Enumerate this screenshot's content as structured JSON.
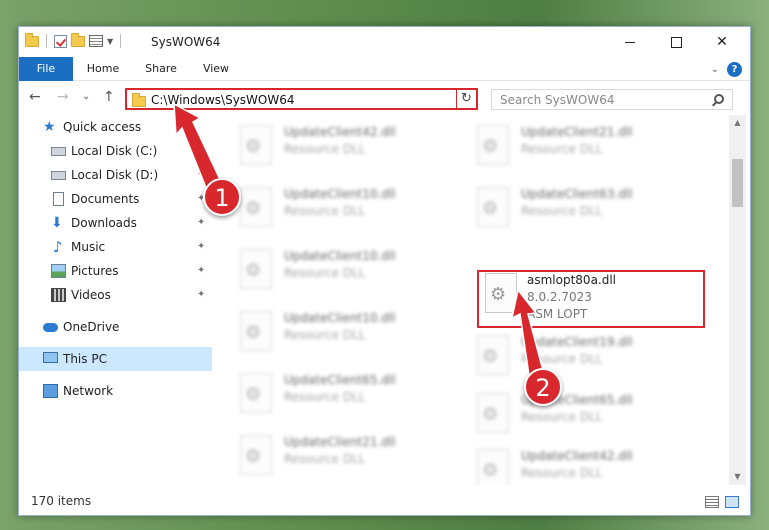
{
  "window": {
    "title": "SysWOW64",
    "controls": {
      "minimize": "",
      "maximize": "",
      "close": "✕"
    }
  },
  "ribbon": {
    "tabs": [
      "File",
      "Home",
      "Share",
      "View"
    ],
    "help": "?"
  },
  "address": {
    "path": "C:\\Windows\\SysWOW64",
    "refresh": "↻",
    "dropdown": "⌄",
    "search_placeholder": "Search SysWOW64"
  },
  "nav_buttons": {
    "back": "←",
    "forward": "→",
    "recent": "⌄",
    "up": "↑"
  },
  "sidebar": {
    "items": [
      {
        "label": "Quick access",
        "icon": "star-icon",
        "pinned": false
      },
      {
        "label": "Local Disk (C:)",
        "icon": "disk-icon",
        "pinned": true
      },
      {
        "label": "Local Disk (D:)",
        "icon": "disk-icon",
        "pinned": true
      },
      {
        "label": "Documents",
        "icon": "documents-icon",
        "pinned": true
      },
      {
        "label": "Downloads",
        "icon": "downloads-icon",
        "pinned": true
      },
      {
        "label": "Music",
        "icon": "music-icon",
        "pinned": true
      },
      {
        "label": "Pictures",
        "icon": "pictures-icon",
        "pinned": true
      },
      {
        "label": "Videos",
        "icon": "videos-icon",
        "pinned": true
      },
      {
        "label": "OneDrive",
        "icon": "onedrive-icon",
        "pinned": false
      },
      {
        "label": "This PC",
        "icon": "this-pc-icon",
        "pinned": false,
        "selected": true
      },
      {
        "label": "Network",
        "icon": "network-icon",
        "pinned": false
      }
    ],
    "pin_glyph": "📌"
  },
  "files": {
    "left": [
      {
        "name": "UpdateClient42.dll",
        "type": "Resource DLL"
      },
      {
        "name": "UpdateClient10.dll",
        "type": "Resource DLL"
      },
      {
        "name": "UpdateClient10.dll",
        "type": "Resource DLL"
      },
      {
        "name": "UpdateClient10.dll",
        "type": "Resource DLL"
      },
      {
        "name": "UpdateClient65.dll",
        "type": "Resource DLL"
      },
      {
        "name": "UpdateClient21.dll",
        "type": "Resource DLL"
      }
    ],
    "right": [
      {
        "name": "UpdateClient21.dll",
        "type": "Resource DLL"
      },
      {
        "name": "UpdateClient63.dll",
        "type": "Resource DLL"
      },
      {
        "name": "asmlopt80a.dll",
        "version": "8.0.2.7023",
        "company": "ASM LOPT",
        "highlighted": true
      },
      {
        "name": "UpdateClient19.dll",
        "type": "Resource DLL"
      },
      {
        "name": "UpdateClient65.dll",
        "type": "Resource DLL"
      },
      {
        "name": "UpdateClient42.dll",
        "type": "Resource DLL"
      }
    ]
  },
  "status": {
    "item_count": "170 items"
  },
  "annotations": {
    "step1": "1",
    "step2": "2",
    "color": "#d9272e"
  }
}
